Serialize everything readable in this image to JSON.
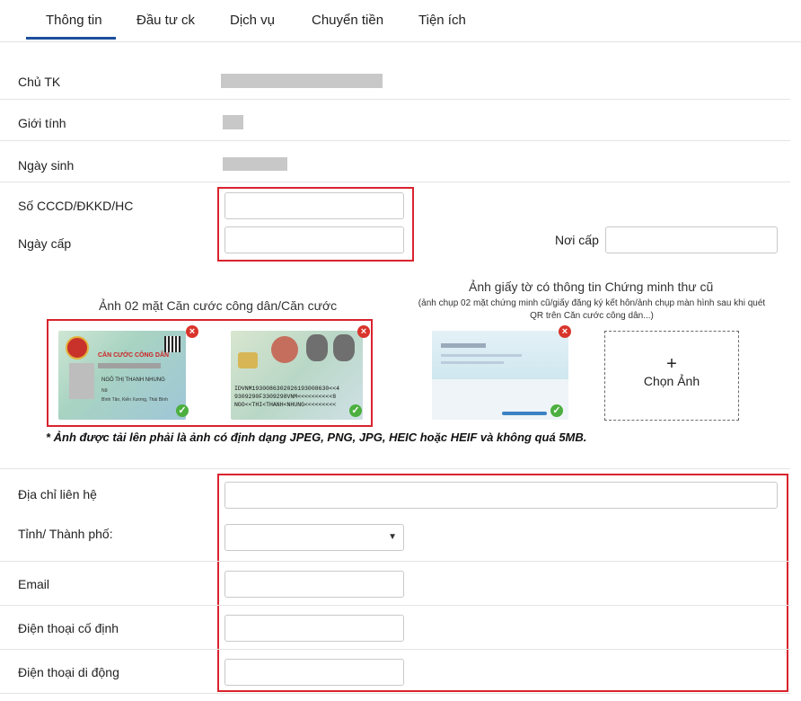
{
  "tabs": [
    "Thông tin",
    "Đầu tư ck",
    "Dịch vụ",
    "Chuyển tiền",
    "Tiện ích"
  ],
  "fields": {
    "owner": "Chủ TK",
    "gender": "Giới tính",
    "dob": "Ngày sinh",
    "id_number": "Số CCCD/ĐKKD/HC",
    "issue_date": "Ngày cấp",
    "issue_place": "Nơi cấp",
    "address": "Địa chỉ liên hệ",
    "province": "Tỉnh/ Thành phố:",
    "email": "Email",
    "landline": "Điện thoại cố định",
    "mobile": "Điện thoại di động"
  },
  "id_images": {
    "caption": "Ảnh 02 mặt Căn cước công dân/Căn cước",
    "front_title": "CĂN CƯỚC CÔNG DÂN",
    "front_name": "NGÔ THỊ THANH NHUNG",
    "front_sex": "Nữ",
    "front_place": "Bình Tân, Kiến Xương, Thái Bình",
    "back_mrz_1": "IDVNM1930086302026193008630<<4",
    "back_mrz_2": "9309290F3309298VNM<<<<<<<<<<8",
    "back_mrz_3": "NGO<<THI<THANH<NHUNG<<<<<<<<<"
  },
  "old_id": {
    "title": "Ảnh giấy tờ có thông tin Chứng minh thư cũ",
    "subtitle": "(ảnh chụp 02 mặt chứng minh cũ/giấy đăng ký kết hôn/ảnh chụp màn hình sau khi quét QR trên Căn cước công dân...)",
    "upload_plus": "+",
    "upload_label": "Chọn Ảnh"
  },
  "note": "* Ảnh được tải lên phải là ảnh có định dạng JPEG, PNG, JPG, HEIC hoặc HEIF và không quá 5MB.",
  "colors": {
    "accent": "#1b4f9c",
    "highlight": "#d9232e",
    "success": "#4caf3f",
    "remove": "#d9342b"
  }
}
